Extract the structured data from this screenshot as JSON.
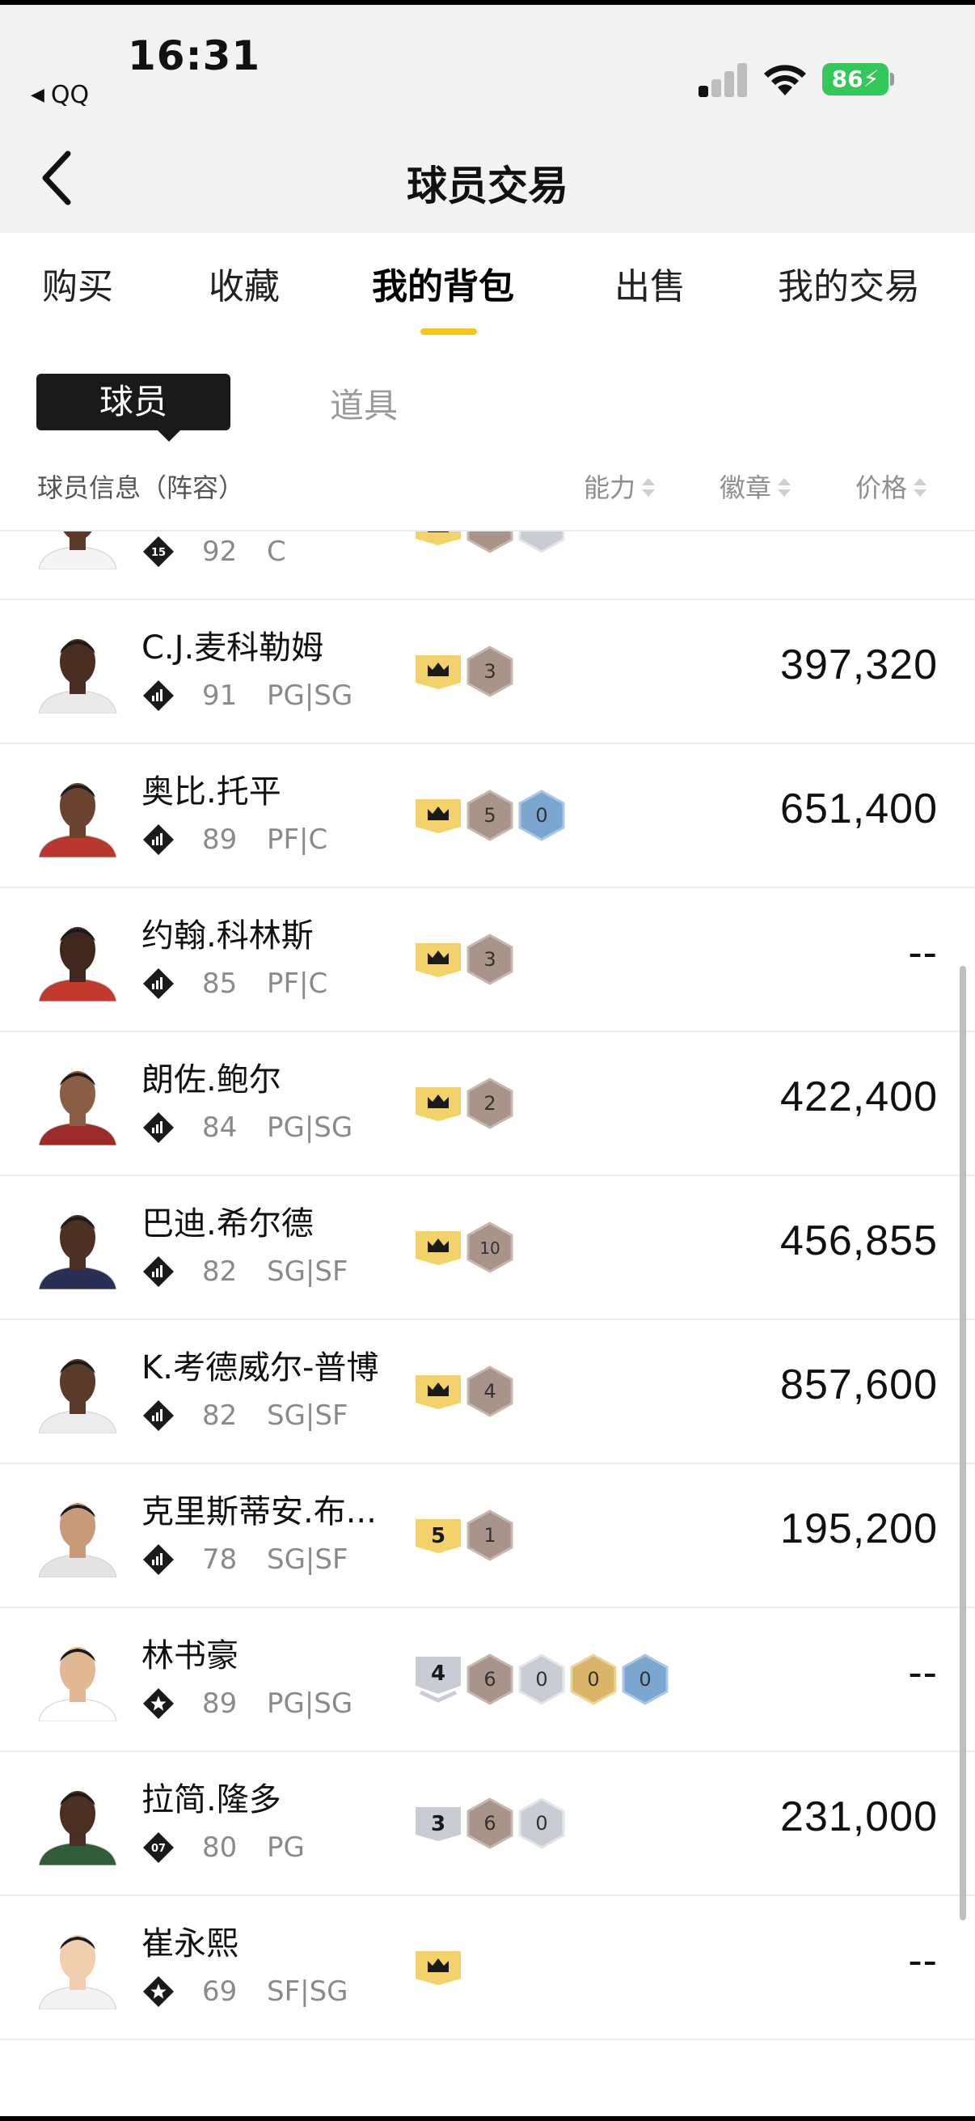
{
  "status_bar": {
    "time": "16:31",
    "back_app": "QQ",
    "battery": "86"
  },
  "header": {
    "title": "球员交易"
  },
  "main_tabs": [
    "购买",
    "收藏",
    "我的背包",
    "出售",
    "我的交易"
  ],
  "active_tab": "我的背包",
  "sub_tabs": {
    "players": "球员",
    "items": "道具"
  },
  "columns": {
    "info": "球员信息（阵容）",
    "ability": "能力",
    "badges": "徽章",
    "price": "价格"
  },
  "colors": {
    "accent": "#f5c518",
    "badge_bronze": "#a8948a",
    "badge_silver": "#c9ccd3",
    "badge_gold": "#d9b56a",
    "badge_blue": "#7aa6cf",
    "crown": "#f2d36b"
  },
  "players": [
    {
      "name": "",
      "rating": "92",
      "position": "C",
      "price": "",
      "tier_icon": "diamond-15-icon",
      "tier_text": "15",
      "badges": [
        {
          "type": "crown"
        },
        {
          "type": "bronze",
          "text": ""
        },
        {
          "type": "silver",
          "text": ""
        }
      ]
    },
    {
      "name": "C.J.麦科勒姆",
      "rating": "91",
      "position": "PG|SG",
      "price": "397,320",
      "tier_icon": "diamond-bars-icon",
      "badges": [
        {
          "type": "crown"
        },
        {
          "type": "bronze",
          "text": "3"
        }
      ]
    },
    {
      "name": "奥比.托平",
      "rating": "89",
      "position": "PF|C",
      "price": "651,400",
      "tier_icon": "diamond-bars-icon",
      "badges": [
        {
          "type": "crown"
        },
        {
          "type": "bronze",
          "text": "5"
        },
        {
          "type": "blue",
          "text": "0"
        }
      ]
    },
    {
      "name": "约翰.科林斯",
      "rating": "85",
      "position": "PF|C",
      "price": "--",
      "tier_icon": "diamond-bars-icon",
      "badges": [
        {
          "type": "crown"
        },
        {
          "type": "bronze",
          "text": "3"
        }
      ]
    },
    {
      "name": "朗佐.鲍尔",
      "rating": "84",
      "position": "PG|SG",
      "price": "422,400",
      "tier_icon": "diamond-bars-icon",
      "badges": [
        {
          "type": "crown"
        },
        {
          "type": "bronze",
          "text": "2"
        }
      ]
    },
    {
      "name": "巴迪.希尔德",
      "rating": "82",
      "position": "SG|SF",
      "price": "456,855",
      "tier_icon": "diamond-bars-icon",
      "badges": [
        {
          "type": "crown"
        },
        {
          "type": "bronze",
          "text": "10"
        }
      ]
    },
    {
      "name": "K.考德威尔-普博",
      "rating": "82",
      "position": "SG|SF",
      "price": "857,600",
      "tier_icon": "diamond-bars-icon",
      "badges": [
        {
          "type": "crown"
        },
        {
          "type": "bronze",
          "text": "4"
        }
      ]
    },
    {
      "name": "克里斯蒂安.布...",
      "rating": "78",
      "position": "SG|SF",
      "price": "195,200",
      "tier_icon": "diamond-bars-icon",
      "badges": [
        {
          "type": "num",
          "text": "5"
        },
        {
          "type": "bronze",
          "text": "1"
        }
      ]
    },
    {
      "name": "林书豪",
      "rating": "89",
      "position": "PG|SG",
      "price": "--",
      "tier_icon": "star-diamond-icon",
      "badges": [
        {
          "type": "rank",
          "text": "4"
        },
        {
          "type": "bronze",
          "text": "6"
        },
        {
          "type": "silver",
          "text": "0"
        },
        {
          "type": "gold",
          "text": "0"
        },
        {
          "type": "blue",
          "text": "0"
        }
      ]
    },
    {
      "name": "拉简.隆多",
      "rating": "80",
      "position": "PG",
      "price": "231,000",
      "tier_icon": "diamond-07-icon",
      "tier_text": "07",
      "badges": [
        {
          "type": "grey",
          "text": "3"
        },
        {
          "type": "bronze",
          "text": "6"
        },
        {
          "type": "silver",
          "text": "0"
        }
      ]
    },
    {
      "name": "崔永熙",
      "rating": "69",
      "position": "SF|SG",
      "price": "--",
      "tier_icon": "star-diamond-icon",
      "badges": [
        {
          "type": "crown"
        }
      ]
    }
  ]
}
